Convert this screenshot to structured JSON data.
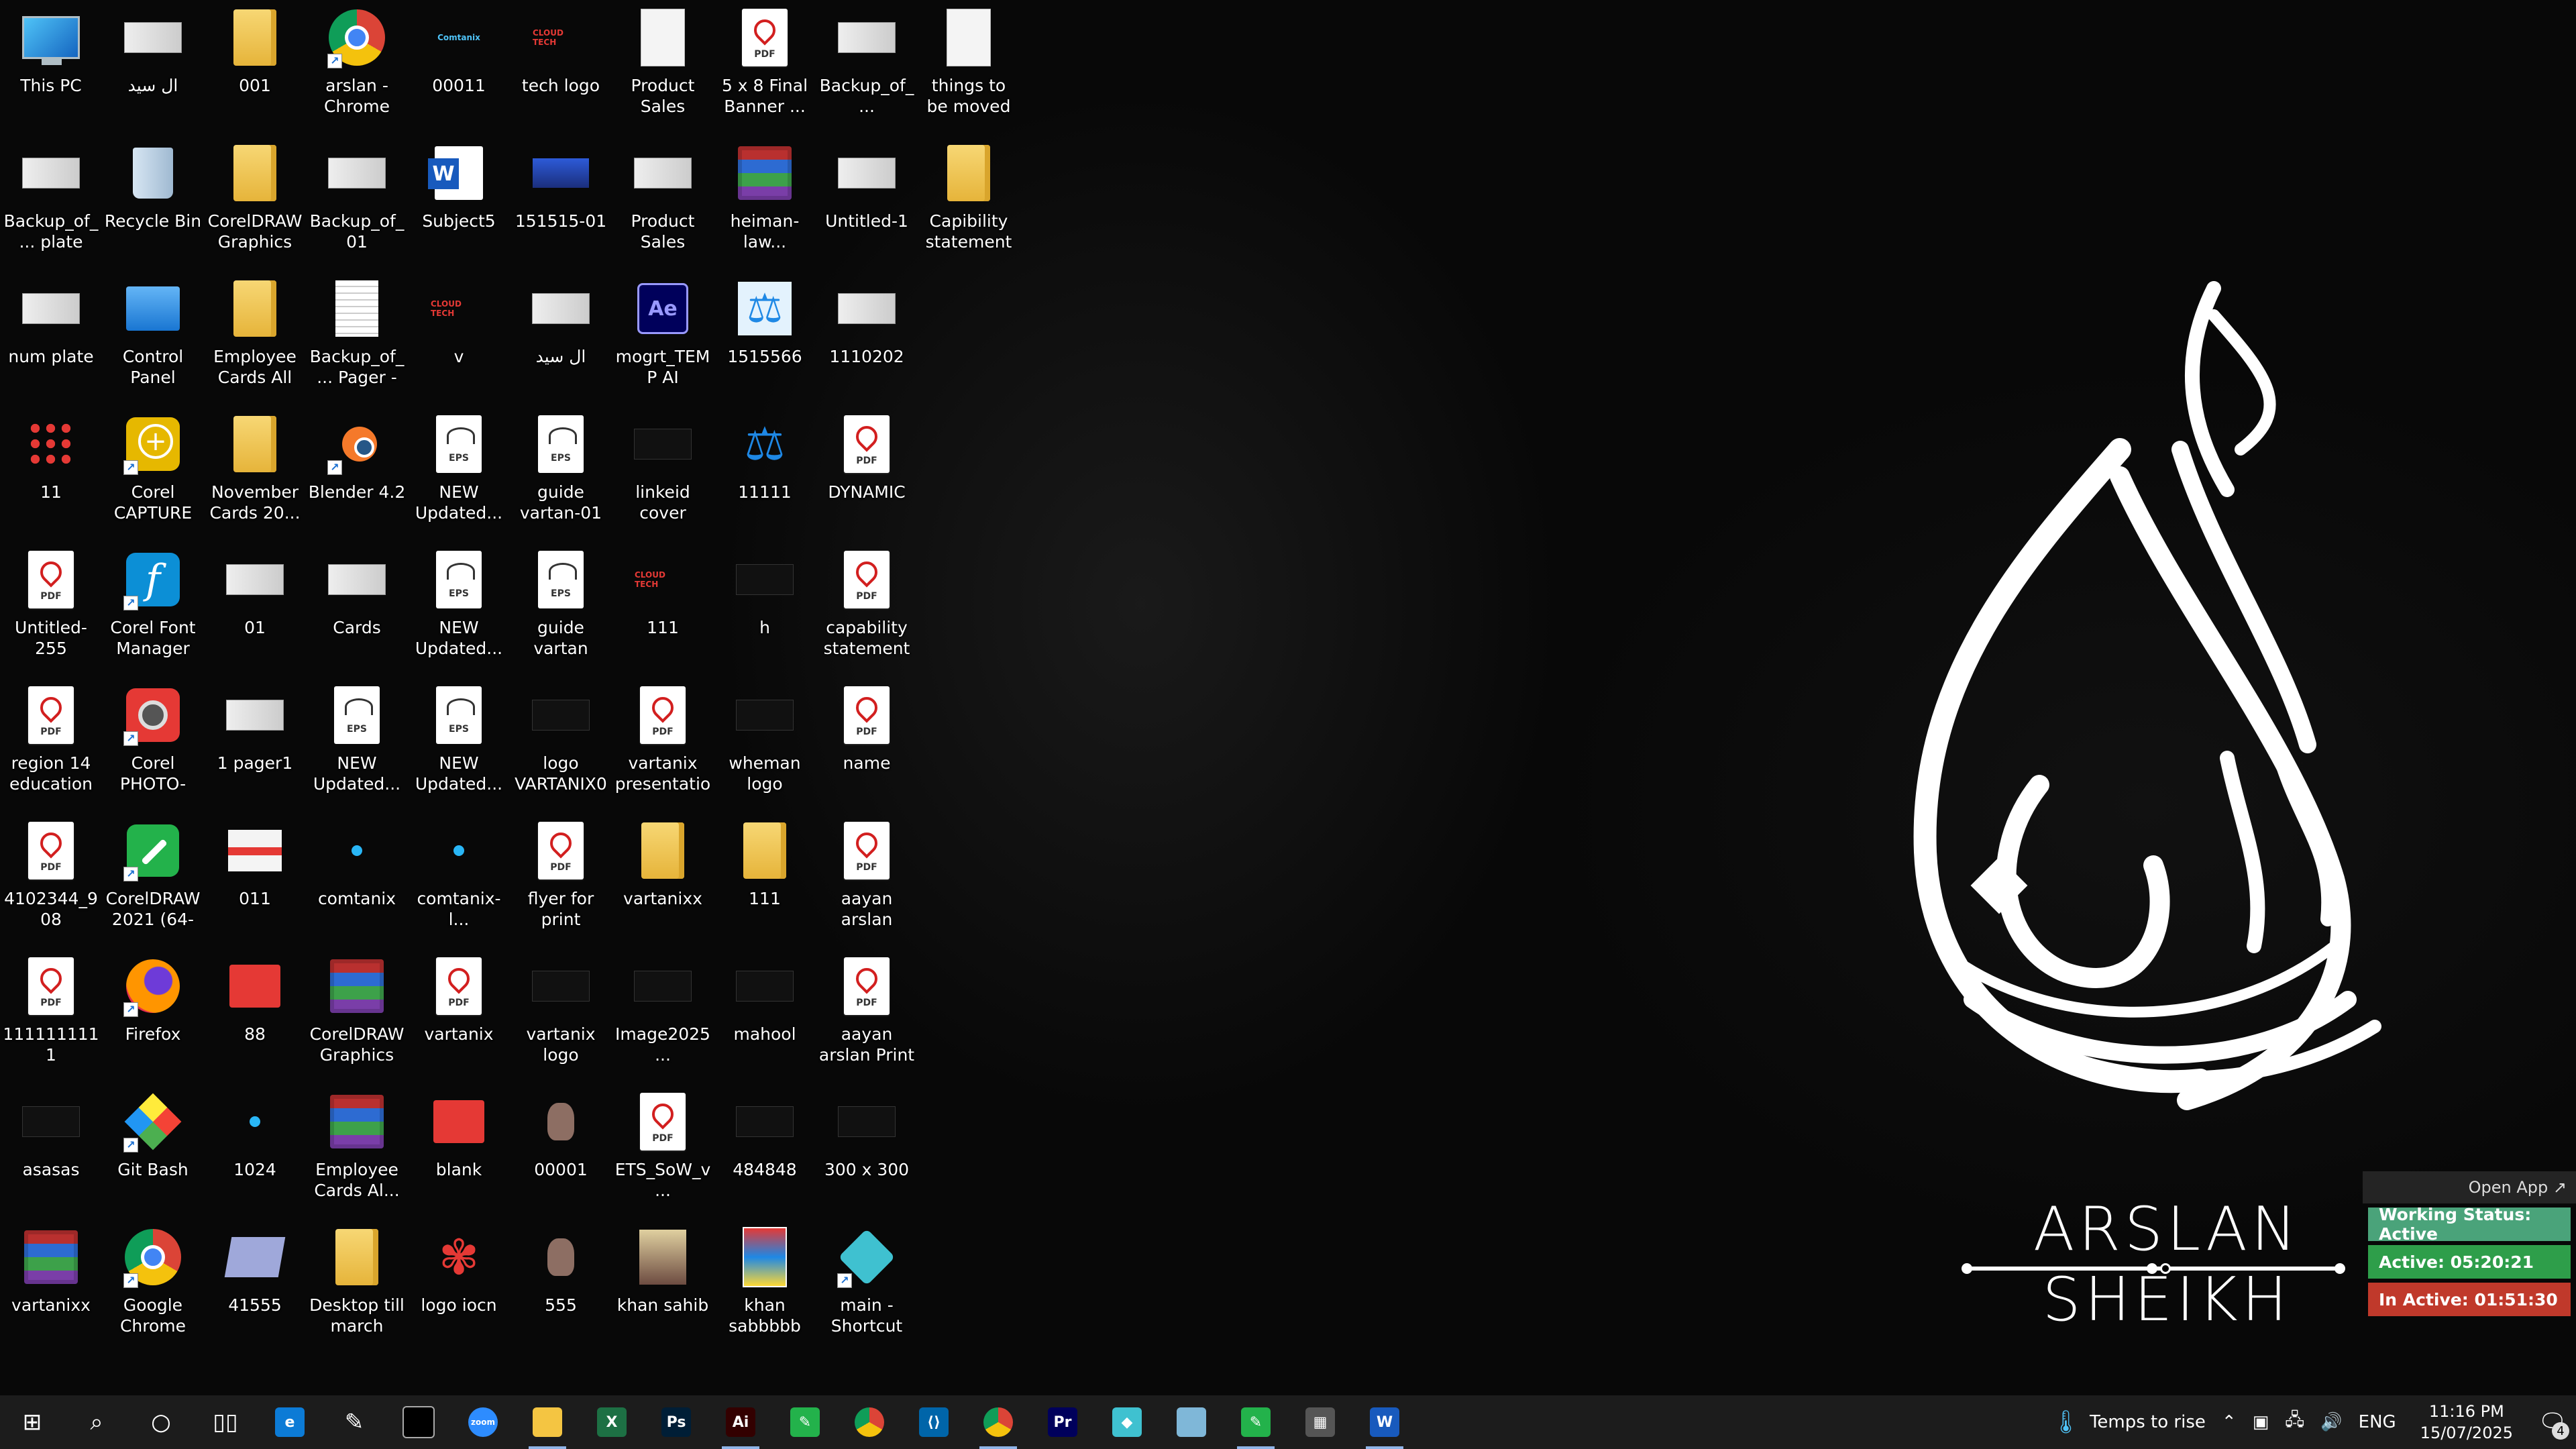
{
  "desktop": {
    "icons": [
      {
        "label": "This PC",
        "icon": "pc"
      },
      {
        "label": "Backup_of_... plate",
        "icon": "thumb-cdr"
      },
      {
        "label": "num plate",
        "icon": "thumb-cdr"
      },
      {
        "label": "11",
        "icon": "grid"
      },
      {
        "label": "Untitled-255",
        "icon": "pdf"
      },
      {
        "label": "region 14 education s...",
        "icon": "pdf"
      },
      {
        "label": "4102344_908",
        "icon": "pdf"
      },
      {
        "label": "1111111111",
        "icon": "pdf"
      },
      {
        "label": "asasas",
        "icon": "dark"
      },
      {
        "label": "vartanixx",
        "icon": "rar"
      },
      {
        "label": "ال سيد",
        "icon": "thumb"
      },
      {
        "label": "Recycle Bin",
        "icon": "bin"
      },
      {
        "label": "Control Panel",
        "icon": "cp"
      },
      {
        "label": "Corel CAPTURE 2...",
        "icon": "corelcap",
        "shortcut": true
      },
      {
        "label": "Corel Font Manager 2...",
        "icon": "font",
        "shortcut": true
      },
      {
        "label": "Corel PHOTO-PAI...",
        "icon": "photo",
        "shortcut": true
      },
      {
        "label": "CorelDRAW 2021 (64-Bit)",
        "icon": "cdr",
        "shortcut": true
      },
      {
        "label": "Firefox",
        "icon": "firefox",
        "shortcut": true
      },
      {
        "label": "Git Bash",
        "icon": "git",
        "shortcut": true
      },
      {
        "label": "Google Chrome",
        "icon": "chrome",
        "shortcut": true
      },
      {
        "label": "001",
        "icon": "folder"
      },
      {
        "label": "CorelDRAW Graphics Su...",
        "icon": "folder"
      },
      {
        "label": "Employee Cards All",
        "icon": "folder"
      },
      {
        "label": "November Cards 20...",
        "icon": "folder"
      },
      {
        "label": "01",
        "icon": "thumb-cdr"
      },
      {
        "label": "1 pager1",
        "icon": "thumb"
      },
      {
        "label": "011",
        "icon": "pink"
      },
      {
        "label": "88",
        "icon": "red"
      },
      {
        "label": "1024",
        "icon": "dot"
      },
      {
        "label": "41555",
        "icon": "notebook"
      },
      {
        "label": "arslan - Chrome",
        "icon": "chrome",
        "shortcut": true
      },
      {
        "label": "Backup_of_01",
        "icon": "thumb-cdr"
      },
      {
        "label": "Backup_of_... Pager - NY...",
        "icon": "doc-cdr"
      },
      {
        "label": "Blender 4.2",
        "icon": "blender",
        "shortcut": true
      },
      {
        "label": "Cards",
        "icon": "thumb"
      },
      {
        "label": "NEW Updated...",
        "icon": "eps"
      },
      {
        "label": "comtanix",
        "icon": "dot"
      },
      {
        "label": "CorelDRAW Graphics Su...",
        "icon": "rar"
      },
      {
        "label": "Employee Cards Al...",
        "icon": "rar"
      },
      {
        "label": "Desktop till march",
        "icon": "folder"
      },
      {
        "label": "00011",
        "icon": "logo-blue"
      },
      {
        "label": "Subject5",
        "icon": "word"
      },
      {
        "label": "v",
        "icon": "logo-red"
      },
      {
        "label": "NEW Updated...",
        "icon": "eps"
      },
      {
        "label": "NEW Updated...",
        "icon": "eps"
      },
      {
        "label": "NEW Updated...",
        "icon": "eps"
      },
      {
        "label": "comtanix-l...",
        "icon": "dot"
      },
      {
        "label": "vartanix",
        "icon": "pdf"
      },
      {
        "label": "blank",
        "icon": "red"
      },
      {
        "label": "logo iocn",
        "icon": "flower"
      },
      {
        "label": "tech logo",
        "icon": "logo-red"
      },
      {
        "label": "151515-01",
        "icon": "blue"
      },
      {
        "label": "ال سيد",
        "icon": "thumb"
      },
      {
        "label": "guide vartan-01",
        "icon": "eps"
      },
      {
        "label": "guide vartan",
        "icon": "eps"
      },
      {
        "label": "logo VARTANIX01",
        "icon": "dark"
      },
      {
        "label": "flyer for print ALsaeed po...",
        "icon": "pdf"
      },
      {
        "label": "vartanix logo",
        "icon": "dark"
      },
      {
        "label": "00001",
        "icon": "brown"
      },
      {
        "label": "555",
        "icon": "brown"
      },
      {
        "label": "Product Sales Promo Pack...",
        "icon": "white"
      },
      {
        "label": "Product Sales Promo Pack...",
        "icon": "thumb"
      },
      {
        "label": "mogrt_TEMP AI (convert...",
        "icon": "ae"
      },
      {
        "label": "linkeid cover",
        "icon": "dark"
      },
      {
        "label": "111",
        "icon": "logo-red"
      },
      {
        "label": "vartanix presentation",
        "icon": "pdf"
      },
      {
        "label": "vartanixx",
        "icon": "folder"
      },
      {
        "label": "Image2025...",
        "icon": "dark"
      },
      {
        "label": "ETS_SoW_v...",
        "icon": "pdf"
      },
      {
        "label": "khan sahib",
        "icon": "kitchen"
      },
      {
        "label": "5 x 8 Final Banner ...",
        "icon": "pdf"
      },
      {
        "label": "heiman-law...",
        "icon": "rar"
      },
      {
        "label": "1515566",
        "icon": "scale2"
      },
      {
        "label": "11111",
        "icon": "scale"
      },
      {
        "label": "h",
        "icon": "dark"
      },
      {
        "label": "wheman logo",
        "icon": "dark"
      },
      {
        "label": "111",
        "icon": "folder"
      },
      {
        "label": "mahool",
        "icon": "dark"
      },
      {
        "label": "484848",
        "icon": "dark"
      },
      {
        "label": "khan sabbbbb",
        "icon": "comic"
      },
      {
        "label": "Backup_of_...",
        "icon": "thumb-cdr"
      },
      {
        "label": "Untitled-1",
        "icon": "thumb-cdr"
      },
      {
        "label": "1110202",
        "icon": "thumb"
      },
      {
        "label": "DYNAMIC",
        "icon": "pdf"
      },
      {
        "label": "capability statement",
        "icon": "pdf"
      },
      {
        "label": "name",
        "icon": "pdf"
      },
      {
        "label": "aayan arslan",
        "icon": "pdf"
      },
      {
        "label": "aayan arslan Print",
        "icon": "pdf"
      },
      {
        "label": "300 x 300",
        "icon": "dark"
      },
      {
        "label": "main - Shortcut",
        "icon": "diamond",
        "shortcut": true
      },
      {
        "label": "things to be moved",
        "icon": "white"
      },
      {
        "label": "Capibility statement ...",
        "icon": "folder-doc"
      }
    ]
  },
  "logo": {
    "name": "ARSLAN SHEIKH",
    "color": "#ffffff"
  },
  "status_widget": {
    "open_app": "Open App ↗",
    "working_status": "Working Status: Active",
    "active": "Active: 05:20:21",
    "inactive": "In Active: 01:51:30"
  },
  "taskbar": {
    "apps": [
      {
        "name": "start",
        "label": "⊞",
        "bg": "transparent"
      },
      {
        "name": "search",
        "label": "⌕",
        "bg": "transparent"
      },
      {
        "name": "cortana",
        "label": "○",
        "bg": "transparent"
      },
      {
        "name": "task-view",
        "label": "▯▯",
        "bg": "transparent"
      },
      {
        "name": "edge",
        "label": "e",
        "bg": "#0c7bd6"
      },
      {
        "name": "pen",
        "label": "✎",
        "bg": "transparent"
      },
      {
        "name": "terminal",
        "label": "",
        "bg": "#000"
      },
      {
        "name": "zoom",
        "label": "zoom",
        "bg": "#2d8cff"
      },
      {
        "name": "file-explorer",
        "label": "",
        "bg": "#f4c542",
        "open": true
      },
      {
        "name": "excel",
        "label": "X",
        "bg": "#1d7044"
      },
      {
        "name": "photoshop",
        "label": "Ps",
        "bg": "#001e36"
      },
      {
        "name": "illustrator",
        "label": "Ai",
        "bg": "#330000",
        "open": true
      },
      {
        "name": "coreldraw",
        "label": "✎",
        "bg": "#23b24b"
      },
      {
        "name": "chrome",
        "label": "",
        "bg": "#db4437"
      },
      {
        "name": "vscode",
        "label": "⟨⟩",
        "bg": "#0065a9"
      },
      {
        "name": "chrome-profile",
        "label": "",
        "bg": "#db4437",
        "open": true
      },
      {
        "name": "premiere",
        "label": "Pr",
        "bg": "#00005b"
      },
      {
        "name": "app-diamond",
        "label": "◆",
        "bg": "#3fc1d0"
      },
      {
        "name": "app-notes",
        "label": "",
        "bg": "#7fb7d8"
      },
      {
        "name": "coreldraw-2",
        "label": "✎",
        "bg": "#23b24b",
        "open": true
      },
      {
        "name": "calculator",
        "label": "▦",
        "bg": "#555"
      },
      {
        "name": "word",
        "label": "W",
        "bg": "#185abd",
        "open": true
      }
    ],
    "weather": "Temps to rise",
    "language": "ENG",
    "time": "11:16 PM",
    "date": "15/07/2025",
    "notifications": "4"
  }
}
